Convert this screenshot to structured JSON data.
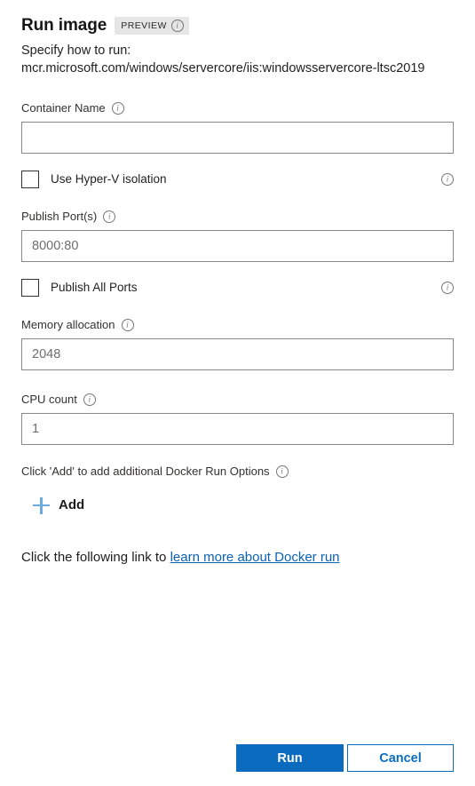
{
  "header": {
    "title": "Run image",
    "badge_label": "PREVIEW",
    "badge_info_icon": "info-icon",
    "subtitle_intro": "Specify how to run:",
    "image_reference": "mcr.microsoft.com/windows/servercore/iis:windowsservercore-ltsc2019"
  },
  "form": {
    "container_name": {
      "label": "Container Name",
      "info_icon": "info-icon",
      "value": "",
      "placeholder": ""
    },
    "hyperv_isolation": {
      "label": "Use Hyper-V isolation",
      "checked": false,
      "info_icon": "info-icon"
    },
    "publish_ports": {
      "label": "Publish Port(s)",
      "info_icon": "info-icon",
      "value": "",
      "placeholder": "8000:80"
    },
    "publish_all_ports": {
      "label": "Publish All Ports",
      "checked": false,
      "info_icon": "info-icon"
    },
    "memory_allocation": {
      "label": "Memory allocation",
      "info_icon": "info-icon",
      "value": "",
      "placeholder": "2048"
    },
    "cpu_count": {
      "label": "CPU count",
      "info_icon": "info-icon",
      "value": "",
      "placeholder": "1"
    },
    "additional_options": {
      "label": "Click 'Add' to add additional Docker Run Options",
      "info_icon": "info-icon",
      "add_label": "Add",
      "add_icon": "plus-icon"
    }
  },
  "link_section": {
    "prefix_text": "Click the following link to ",
    "link_text": "learn more about Docker run"
  },
  "footer": {
    "run_label": "Run",
    "cancel_label": "Cancel"
  },
  "colors": {
    "accent": "#0b6cbf",
    "link": "#0b62b6",
    "plus": "#6ca9dc",
    "badge_bg": "#e6e6e6",
    "input_border": "#8a8886",
    "text": "#1b1b1b"
  }
}
